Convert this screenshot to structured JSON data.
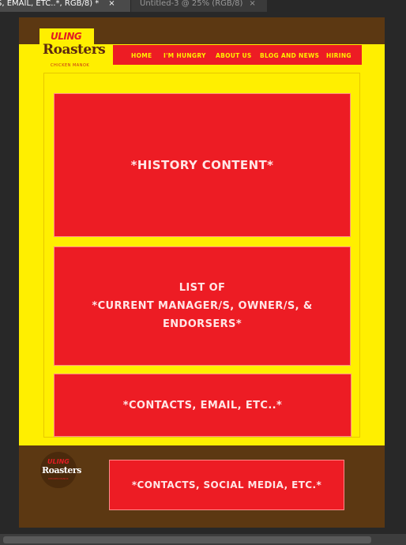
{
  "tabs": [
    {
      "label": "S, EMAIL, ETC..*, RGB/8) *",
      "close": "×"
    },
    {
      "label": "Untitled-3 @ 25% (RGB/8)",
      "close": "×"
    }
  ],
  "logo": {
    "top": "ULING",
    "main": "Roasters",
    "tag": "CHICKEN MANOK"
  },
  "nav": {
    "home": "HOME",
    "hungry": "I'M HUNGRY",
    "about": "ABOUT US",
    "blog": "BLOG AND NEWS",
    "hiring": "HIRING"
  },
  "content": {
    "history": "*HISTORY CONTENT*",
    "list_line1": "LIST OF",
    "list_line2": "*CURRENT MANAGER/S, OWNER/S, & ENDORSERS*",
    "contacts": "*CONTACTS, EMAIL, ETC..*"
  },
  "footer": {
    "logo_top": "ULING",
    "logo_main": "Roasters",
    "logo_tag": "CHICKEN MANOK",
    "contacts": "*CONTACTS, SOCIAL MEDIA, ETC.*"
  },
  "colors": {
    "brown": "#5c3812",
    "yellow": "#ffef00",
    "red": "#ed1c24"
  }
}
